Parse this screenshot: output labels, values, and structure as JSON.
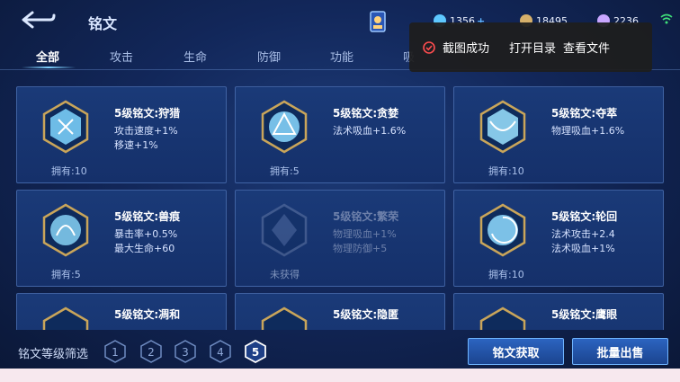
{
  "header": {
    "title": "铭文",
    "resources": [
      {
        "icon": "diamond-icon",
        "value": "1356",
        "color": "#5ec8ff"
      },
      {
        "icon": "gold-coin-icon",
        "value": "18495",
        "color": "#d6b06a"
      },
      {
        "icon": "crystal-icon",
        "value": "2236",
        "color": "#c9a6ff"
      }
    ],
    "plus_symbol": "+"
  },
  "tabs": [
    "全部",
    "攻击",
    "生命",
    "防御",
    "功能",
    "吸"
  ],
  "active_tab": 0,
  "toast": {
    "message": "截图成功",
    "open_folder": "打开目录",
    "view_file": "查看文件"
  },
  "cards": [
    {
      "name": "5级铭文:狩猎",
      "stats": [
        "攻击速度+1%",
        "移速+1%"
      ],
      "owned": "拥有:10",
      "locked": false,
      "color": "#7fd6ff"
    },
    {
      "name": "5级铭文:贪婪",
      "stats": [
        "法术吸血+1.6%"
      ],
      "owned": "拥有:5",
      "locked": false,
      "color": "#8ad9ff"
    },
    {
      "name": "5级铭文:夺萃",
      "stats": [
        "物理吸血+1.6%"
      ],
      "owned": "拥有:10",
      "locked": false,
      "color": "#9be3ff"
    },
    {
      "name": "5级铭文:兽痕",
      "stats": [
        "暴击率+0.5%",
        "最大生命+60"
      ],
      "owned": "拥有:5",
      "locked": false,
      "color": "#86d2f5"
    },
    {
      "name": "5级铭文:繁荣",
      "stats": [
        "物理吸血+1%",
        "物理防御+5"
      ],
      "owned": "未获得",
      "locked": true,
      "color": "#6f86b5"
    },
    {
      "name": "5级铭文:轮回",
      "stats": [
        "法术攻击+2.4",
        "法术吸血+1%"
      ],
      "owned": "拥有:10",
      "locked": false,
      "color": "#8fdcff"
    },
    {
      "name": "5级铭文:凋和",
      "stats": [],
      "owned": "",
      "locked": false,
      "color": "#7fd6ff"
    },
    {
      "name": "5级铭文:隐匿",
      "stats": [],
      "owned": "",
      "locked": false,
      "color": "#7fd6ff"
    },
    {
      "name": "5级铭文:鹰眼",
      "stats": [],
      "owned": "",
      "locked": false,
      "color": "#7fd6ff"
    }
  ],
  "footer": {
    "filter_label": "铭文等级筛选",
    "levels": [
      "1",
      "2",
      "3",
      "4",
      "5"
    ],
    "selected_level": "5",
    "get_button": "铭文获取",
    "sell_button": "批量出售"
  }
}
